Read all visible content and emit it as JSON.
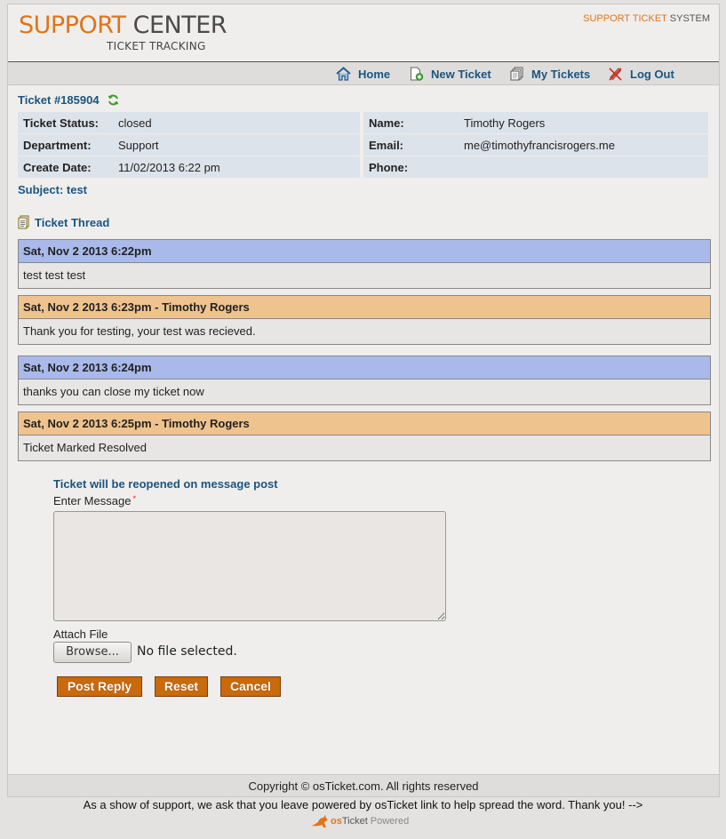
{
  "header": {
    "logo_word1": "SUPPORT",
    "logo_word2": "CENTER",
    "logo_sub": "TICKET TRACKING",
    "system_orange": "SUPPORT TICKET",
    "system_gray": "SYSTEM"
  },
  "nav": {
    "home": "Home",
    "new_ticket": "New Ticket",
    "my_tickets": "My Tickets",
    "log_out": "Log Out"
  },
  "ticket": {
    "title": "Ticket #185904",
    "status_label": "Ticket Status:",
    "status_value": "closed",
    "department_label": "Department:",
    "department_value": "Support",
    "create_date_label": "Create Date:",
    "create_date_value": "11/02/2013 6:22 pm",
    "name_label": "Name:",
    "name_value": "Timothy Rogers",
    "email_label": "Email:",
    "email_value": "me@timothyfrancisrogers.me",
    "phone_label": "Phone:",
    "phone_value": "",
    "subject": "Subject: test"
  },
  "thread": {
    "title": "Ticket Thread",
    "entries": [
      {
        "type": "message",
        "header": "Sat, Nov 2 2013 6:22pm",
        "body": "test test test"
      },
      {
        "type": "response",
        "header": "Sat, Nov 2 2013 6:23pm - Timothy Rogers",
        "body": "Thank you for testing, your test was recieved."
      },
      {
        "type": "message",
        "header": "Sat, Nov 2 2013 6:24pm",
        "body": "thanks you can close my ticket now"
      },
      {
        "type": "response",
        "header": "Sat, Nov 2 2013 6:25pm - Timothy Rogers",
        "body": "Ticket Marked Resolved"
      }
    ]
  },
  "reply": {
    "notice": "Ticket will be reopened on message post",
    "message_label": "Enter Message",
    "required_mark": "*",
    "message_value": "",
    "attach_label": "Attach File",
    "browse_label": "Browse...",
    "file_status": "No file selected.",
    "post_reply": "Post Reply",
    "reset": "Reset",
    "cancel": "Cancel"
  },
  "footer": {
    "copyright": "Copyright © osTicket.com. All rights reserved",
    "support_note": "As a show of support, we ask that you leave powered by osTicket link to help spread the word. Thank you! -->",
    "powered_os": "os",
    "powered_ticket": "Ticket",
    "powered_word": "Powered"
  },
  "colors": {
    "brand_orange": "#e0741a",
    "link_blue": "#1a5580",
    "message_header": "#a9b9ea",
    "response_header": "#efc38e",
    "button_orange": "#c96a0d"
  }
}
